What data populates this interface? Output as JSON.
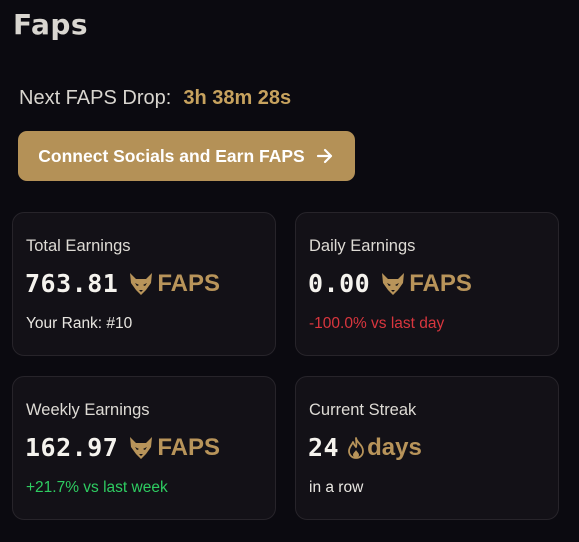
{
  "page": {
    "title": "Faps"
  },
  "drop": {
    "label": "Next FAPS Drop:",
    "timer": "3h 38m 28s"
  },
  "cta": {
    "label": "Connect Socials and Earn FAPS"
  },
  "cards": {
    "total": {
      "label": "Total Earnings",
      "value": "763.81",
      "unit": "FAPS",
      "sub": "Your Rank: #10"
    },
    "daily": {
      "label": "Daily Earnings",
      "value": "0.00",
      "unit": "FAPS",
      "sub": "-100.0% vs last day"
    },
    "weekly": {
      "label": "Weekly Earnings",
      "value": "162.97",
      "unit": "FAPS",
      "sub": "+21.7% vs last week"
    },
    "streak": {
      "label": "Current Streak",
      "value": "24",
      "unit": "days",
      "sub": "in a row"
    }
  },
  "icons": {
    "unit_icon": "fox-head-icon",
    "streak_icon": "flame-icon",
    "cta_icon": "arrow-right-icon"
  },
  "colors": {
    "background": "#0b0a10",
    "accent_gold": "#b49157",
    "negative": "#d9363e",
    "positive": "#2ecc61"
  }
}
